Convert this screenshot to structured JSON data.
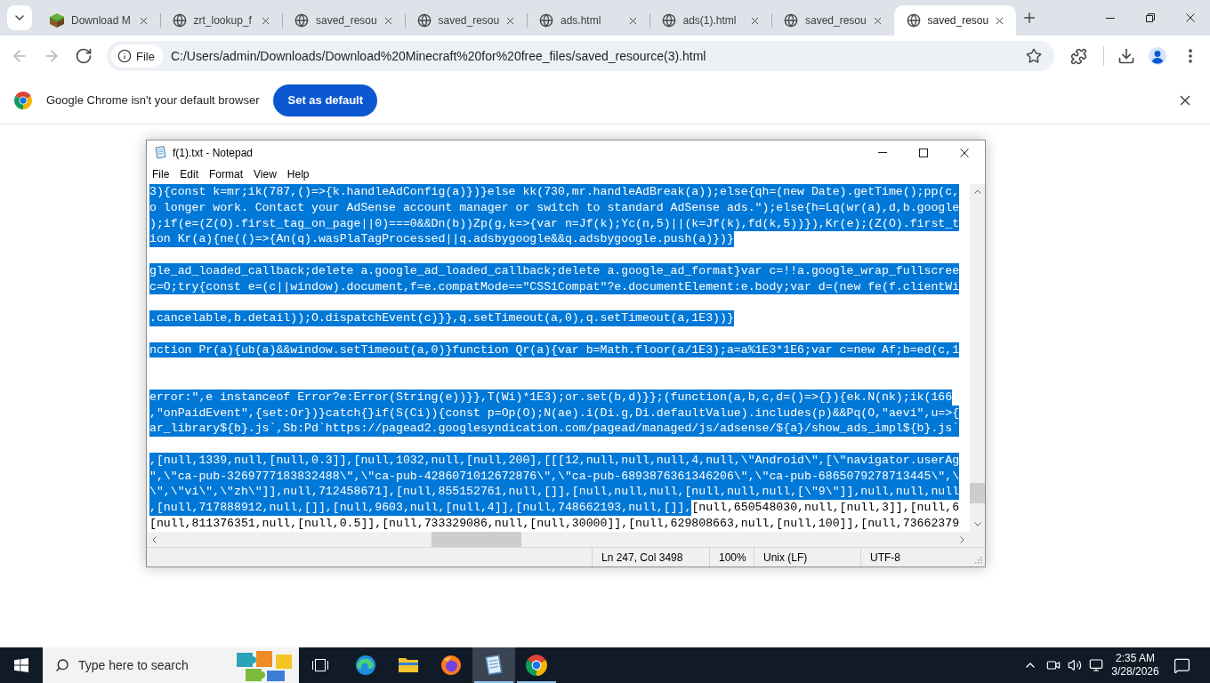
{
  "browser": {
    "tabs": [
      {
        "title": "Download M",
        "kind": "site",
        "selected": false
      },
      {
        "title": "zrt_lookup_f",
        "kind": "page",
        "selected": false
      },
      {
        "title": "saved_resou",
        "kind": "page",
        "selected": false
      },
      {
        "title": "saved_resou",
        "kind": "page",
        "selected": false
      },
      {
        "title": "ads.html",
        "kind": "page",
        "selected": false
      },
      {
        "title": "ads(1).html",
        "kind": "page",
        "selected": false
      },
      {
        "title": "saved_resou",
        "kind": "page",
        "selected": false
      },
      {
        "title": "saved_resou",
        "kind": "page",
        "selected": true
      }
    ],
    "navigation": [
      {
        "kind": "back",
        "disabled": true
      },
      {
        "kind": "forward",
        "disabled": true
      },
      {
        "kind": "reload",
        "disabled": false
      }
    ],
    "address_bar": {
      "chip": "File",
      "value": "C:/Users/admin/Downloads/Download%20Minecraft%20for%20free_files/saved_resource(3).html"
    },
    "infobar": {
      "message": "Google Chrome isn't your default browser",
      "button": "Set as default"
    }
  },
  "notepad": {
    "title": "f(1).txt - Notepad",
    "menu": [
      "File",
      "Edit",
      "Format",
      "View",
      "Help"
    ],
    "lines": [
      {
        "kind": "text",
        "spans": [
          {
            "text": "3){const k=mr;ik(787,()=>{k.handleAdConfig(a)})}else kk(730,mr.handleAdBreak(a));else{qh=(new Date).getTime();pp(c,",
            "selected": true
          }
        ]
      },
      {
        "kind": "text",
        "spans": [
          {
            "text": "o longer work. Contact your AdSense account manager or switch to standard AdSense ads.\");else{h=Lq(wr(a),d,b.google",
            "selected": true
          }
        ]
      },
      {
        "kind": "text",
        "spans": [
          {
            "text": ");if(e=(Z(O).first_tag_on_page||0)===0&&Dn(b))Zp(g,k=>{var n=Jf(k);Yc(n,5)||(k=Jf(k),fd(k,5))}),Kr(e);(Z(O).first_t",
            "selected": true
          }
        ]
      },
      {
        "kind": "text",
        "spans": [
          {
            "text": "ion Kr(a){ne(()=>{An(q).wasPlaTagProcessed||q.adsbygoogle&&q.adsbygoogle.push(a)})}",
            "selected": true
          }
        ]
      },
      {
        "kind": "blank"
      },
      {
        "kind": "text",
        "spans": [
          {
            "text": "gle_ad_loaded_callback;delete a.google_ad_loaded_callback;delete a.google_ad_format}var c=!!a.google_wrap_fullscree",
            "selected": true
          }
        ]
      },
      {
        "kind": "text",
        "spans": [
          {
            "text": "c=O;try{const e=(c||window).document,f=e.compatMode==\"CSS1Compat\"?e.documentElement:e.body;var d=(new fe(f.clientWi",
            "selected": true
          }
        ]
      },
      {
        "kind": "blank"
      },
      {
        "kind": "text",
        "spans": [
          {
            "text": ".cancelable,b.detail));O.dispatchEvent(c)}},q.setTimeout(a,0),q.setTimeout(a,1E3))}",
            "selected": true
          }
        ]
      },
      {
        "kind": "blank"
      },
      {
        "kind": "text",
        "spans": [
          {
            "text": "nction Pr(a){ub(a)&&window.setTimeout(a,0)}function Qr(a){var b=Math.floor(a/1E3);a=a%1E3*1E6;var c=new Af;b=ed(c,1",
            "selected": true
          }
        ]
      },
      {
        "kind": "blank"
      },
      {
        "kind": "blank"
      },
      {
        "kind": "text",
        "spans": [
          {
            "text": "error:\",e instanceof Error?e:Error(String(e))}},T(Wi)*1E3);or.set(b,d)}};(function(a,b,c,d=()=>{}){ek.N(nk);ik(166",
            "selected": true
          }
        ]
      },
      {
        "kind": "text",
        "spans": [
          {
            "text": ",\"onPaidEvent\",{set:Or})}catch{}if(S(Ci)){const p=Op(O);N(ae).i(Di.g,Di.defaultValue).includes(p)&&Pq(O,\"aevi\",u=>{",
            "selected": true
          }
        ]
      },
      {
        "kind": "text",
        "spans": [
          {
            "text": "ar_library${b}.js`,Sb:Pd`https://pagead2.googlesyndication.com/pagead/managed/js/adsense/${a}/show_ads_impl${b}.js`",
            "selected": true
          }
        ]
      },
      {
        "kind": "blank"
      },
      {
        "kind": "text",
        "spans": [
          {
            "text": ",[null,1339,null,[null,0.3]],[null,1032,null,[null,200],[[[12,null,null,null,4,null,\\\"Android\\\",[\\\"navigator.userAg",
            "selected": true
          }
        ]
      },
      {
        "kind": "text",
        "spans": [
          {
            "text": "\",\\\"ca-pub-3269777183832488\\\",\\\"ca-pub-4286071012672876\\\",\\\"ca-pub-6893876361346206\\\",\\\"ca-pub-6865079278713445\\\",\\",
            "selected": true
          }
        ]
      },
      {
        "kind": "text",
        "spans": [
          {
            "text": "\\\",\\\"vi\\\",\\\"zh\\\"]],null,712458671],[null,855152761,null,[]],[null,null,null,[null,null,null,[\\\"9\\\"]],null,null,null",
            "selected": true
          }
        ]
      },
      {
        "kind": "text",
        "spans": [
          {
            "text": ",[null,717888912,null,[]],[null,9603,null,[null,4]],[null,748662193,null,[]],",
            "selected": true
          },
          {
            "text": "[null,650548030,null,[null,3]],[null,6",
            "selected": false
          }
        ]
      },
      {
        "kind": "text",
        "spans": [
          {
            "text": "[null,811376351,null,[null,0.5]],[null,733329086,null,[null,30000]],[null,629808663,null,[null,100]],[null,73662379",
            "selected": false
          }
        ]
      }
    ],
    "status_bar": [
      "Ln 247, Col 3498",
      "100%",
      "Unix (LF)",
      "UTF-8"
    ]
  },
  "taskbar": {
    "search": {
      "placeholder": "Type here to search"
    },
    "apps": [
      {
        "kind": "edge",
        "running": false,
        "selected": false
      },
      {
        "kind": "explorer",
        "running": false,
        "selected": false
      },
      {
        "kind": "firefox",
        "running": false,
        "selected": false
      },
      {
        "kind": "notepad",
        "running": true,
        "selected": true
      },
      {
        "kind": "chrome",
        "running": true,
        "selected": false
      }
    ],
    "clock": {
      "time": "2:35 AM",
      "date": "3/28/2026"
    }
  }
}
